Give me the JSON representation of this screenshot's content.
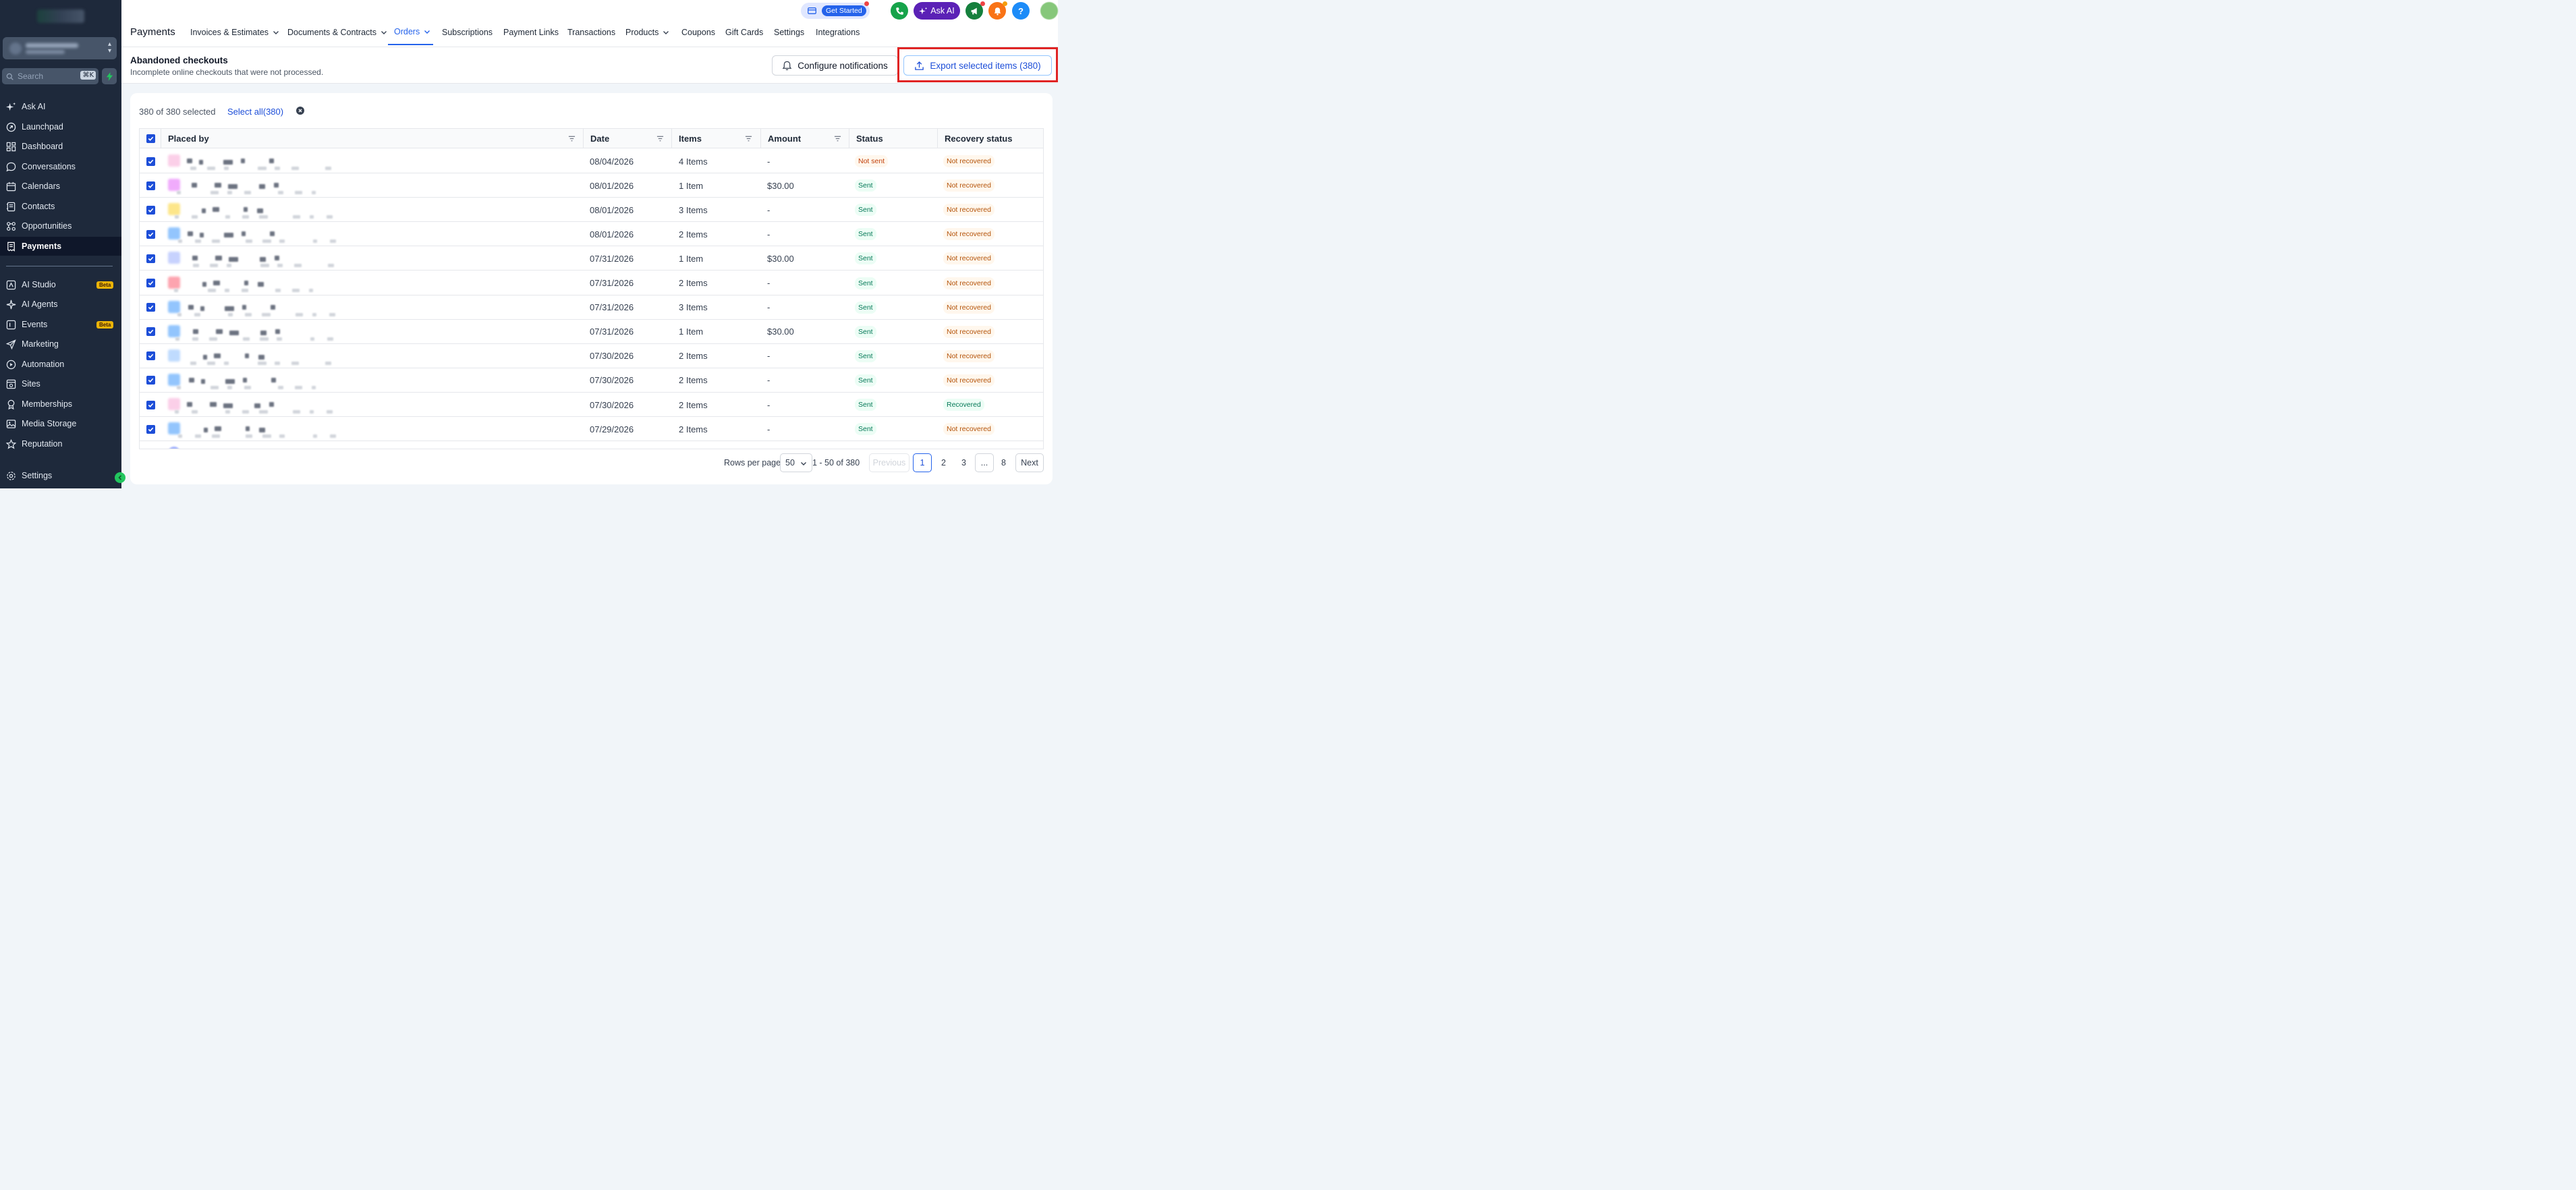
{
  "sidebar": {
    "search_placeholder": "Search",
    "search_shortcut": "⌘K",
    "items": [
      {
        "label": "Ask AI",
        "icon": "sparkle-icon"
      },
      {
        "label": "Launchpad",
        "icon": "rocket-icon"
      },
      {
        "label": "Dashboard",
        "icon": "dashboard-icon"
      },
      {
        "label": "Conversations",
        "icon": "chat-icon"
      },
      {
        "label": "Calendars",
        "icon": "calendar-icon"
      },
      {
        "label": "Contacts",
        "icon": "contacts-icon"
      },
      {
        "label": "Opportunities",
        "icon": "opportunities-icon"
      },
      {
        "label": "Payments",
        "icon": "receipt-icon",
        "active": true
      }
    ],
    "items2": [
      {
        "label": "AI Studio",
        "icon": "ai-studio-icon",
        "badge": "Beta"
      },
      {
        "label": "AI Agents",
        "icon": "ai-agents-icon"
      },
      {
        "label": "Events",
        "icon": "events-icon",
        "badge": "Beta"
      },
      {
        "label": "Marketing",
        "icon": "send-icon"
      },
      {
        "label": "Automation",
        "icon": "automation-icon"
      },
      {
        "label": "Sites",
        "icon": "sites-icon"
      },
      {
        "label": "Memberships",
        "icon": "award-icon"
      },
      {
        "label": "Media Storage",
        "icon": "image-icon"
      },
      {
        "label": "Reputation",
        "icon": "star-icon"
      }
    ],
    "settings_label": "Settings"
  },
  "topnav": {
    "page_title": "Payments",
    "tabs": [
      {
        "label": "Invoices & Estimates",
        "dropdown": true
      },
      {
        "label": "Documents & Contracts",
        "dropdown": true
      },
      {
        "label": "Orders",
        "dropdown": true,
        "active": true
      },
      {
        "label": "Subscriptions"
      },
      {
        "label": "Payment Links"
      },
      {
        "label": "Transactions"
      },
      {
        "label": "Products",
        "dropdown": true
      },
      {
        "label": "Coupons"
      },
      {
        "label": "Gift Cards"
      },
      {
        "label": "Settings"
      },
      {
        "label": "Integrations"
      }
    ],
    "get_started": "Get Started",
    "ask_ai": "Ask AI"
  },
  "header": {
    "title": "Abandoned checkouts",
    "subtitle": "Incomplete online checkouts that were not processed.",
    "configure_label": "Configure notifications",
    "export_label": "Export selected items (380)"
  },
  "selection": {
    "text": "380 of 380 selected",
    "select_all": "Select all(380)"
  },
  "table": {
    "columns": [
      "Placed by",
      "Date",
      "Items",
      "Amount",
      "Status",
      "Recovery status"
    ],
    "rows": [
      {
        "date": "08/04/2026",
        "items": "4 Items",
        "amount": "-",
        "status": "Not sent",
        "recovery": "Not recovered"
      },
      {
        "date": "08/01/2026",
        "items": "1 Item",
        "amount": "$30.00",
        "status": "Sent",
        "recovery": "Not recovered"
      },
      {
        "date": "08/01/2026",
        "items": "3 Items",
        "amount": "-",
        "status": "Sent",
        "recovery": "Not recovered"
      },
      {
        "date": "08/01/2026",
        "items": "2 Items",
        "amount": "-",
        "status": "Sent",
        "recovery": "Not recovered"
      },
      {
        "date": "07/31/2026",
        "items": "1 Item",
        "amount": "$30.00",
        "status": "Sent",
        "recovery": "Not recovered"
      },
      {
        "date": "07/31/2026",
        "items": "2 Items",
        "amount": "-",
        "status": "Sent",
        "recovery": "Not recovered"
      },
      {
        "date": "07/31/2026",
        "items": "3 Items",
        "amount": "-",
        "status": "Sent",
        "recovery": "Not recovered"
      },
      {
        "date": "07/31/2026",
        "items": "1 Item",
        "amount": "$30.00",
        "status": "Sent",
        "recovery": "Not recovered"
      },
      {
        "date": "07/30/2026",
        "items": "2 Items",
        "amount": "-",
        "status": "Sent",
        "recovery": "Not recovered"
      },
      {
        "date": "07/30/2026",
        "items": "2 Items",
        "amount": "-",
        "status": "Sent",
        "recovery": "Not recovered"
      },
      {
        "date": "07/30/2026",
        "items": "2 Items",
        "amount": "-",
        "status": "Sent",
        "recovery": "Recovered"
      },
      {
        "date": "07/29/2026",
        "items": "2 Items",
        "amount": "-",
        "status": "Sent",
        "recovery": "Not recovered"
      }
    ]
  },
  "pagination": {
    "rows_per_page_label": "Rows per page",
    "rows_per_page": "50",
    "range": "1 - 50 of 380",
    "previous": "Previous",
    "pages": [
      "1",
      "2",
      "3",
      "...",
      "8"
    ],
    "next": "Next"
  },
  "colors": {
    "accent": "#2563eb",
    "sidebar_bg": "#1e293b",
    "highlight_outline": "#e02424"
  }
}
